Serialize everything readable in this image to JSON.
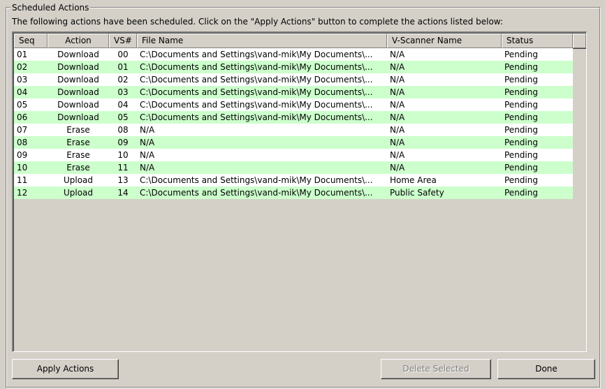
{
  "group": {
    "title": "Scheduled Actions",
    "instructions": "The following actions have been scheduled.  Click on the \"Apply Actions\" button to complete the actions listed below:"
  },
  "table": {
    "columns": [
      "Seq",
      "Action",
      "VS#",
      "File Name",
      "V-Scanner Name",
      "Status"
    ],
    "rows": [
      {
        "seq": "01",
        "action": "Download",
        "vs": "00",
        "file": "C:\\Documents and Settings\\vand-mik\\My Documents\\...",
        "scanner": "N/A",
        "status": "Pending"
      },
      {
        "seq": "02",
        "action": "Download",
        "vs": "01",
        "file": "C:\\Documents and Settings\\vand-mik\\My Documents\\...",
        "scanner": "N/A",
        "status": "Pending"
      },
      {
        "seq": "03",
        "action": "Download",
        "vs": "02",
        "file": "C:\\Documents and Settings\\vand-mik\\My Documents\\...",
        "scanner": "N/A",
        "status": "Pending"
      },
      {
        "seq": "04",
        "action": "Download",
        "vs": "03",
        "file": "C:\\Documents and Settings\\vand-mik\\My Documents\\...",
        "scanner": "N/A",
        "status": "Pending"
      },
      {
        "seq": "05",
        "action": "Download",
        "vs": "04",
        "file": "C:\\Documents and Settings\\vand-mik\\My Documents\\...",
        "scanner": "N/A",
        "status": "Pending"
      },
      {
        "seq": "06",
        "action": "Download",
        "vs": "05",
        "file": "C:\\Documents and Settings\\vand-mik\\My Documents\\...",
        "scanner": "N/A",
        "status": "Pending"
      },
      {
        "seq": "07",
        "action": "Erase",
        "vs": "08",
        "file": "N/A",
        "scanner": "N/A",
        "status": "Pending"
      },
      {
        "seq": "08",
        "action": "Erase",
        "vs": "09",
        "file": "N/A",
        "scanner": "N/A",
        "status": "Pending"
      },
      {
        "seq": "09",
        "action": "Erase",
        "vs": "10",
        "file": "N/A",
        "scanner": "N/A",
        "status": "Pending"
      },
      {
        "seq": "10",
        "action": "Erase",
        "vs": "11",
        "file": "N/A",
        "scanner": "N/A",
        "status": "Pending"
      },
      {
        "seq": "11",
        "action": "Upload",
        "vs": "13",
        "file": "C:\\Documents and Settings\\vand-mik\\My Documents\\...",
        "scanner": "Home Area",
        "status": "Pending"
      },
      {
        "seq": "12",
        "action": "Upload",
        "vs": "14",
        "file": "C:\\Documents and Settings\\vand-mik\\My Documents\\...",
        "scanner": "Public Safety",
        "status": "Pending"
      }
    ]
  },
  "buttons": {
    "apply": "Apply Actions",
    "delete": "Delete Selected",
    "done": "Done"
  },
  "colors": {
    "window_bg": "#d4d0c8",
    "row_alt_bg": "#ccffcc",
    "row_bg": "#ffffff"
  }
}
